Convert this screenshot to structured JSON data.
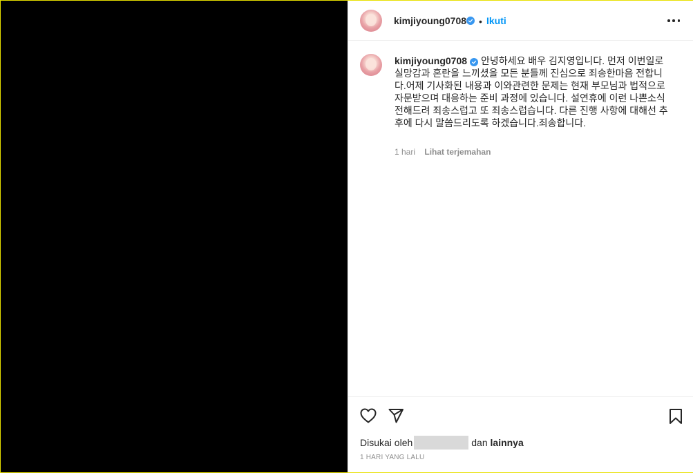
{
  "post": {
    "username": "kimjiyoung0708",
    "follow_label": "Ikuti",
    "separator": "•",
    "caption": "안녕하세요 배우 김지영입니다. 먼저 이번일로 실망감과 혼란을 느끼셨을 모든 분들께 진심으로 죄송한마음 전합니다.어제 기사화된 내용과 이와관련한 문제는 현재 부모님과 법적으로 자문받으며 대응하는 준비 과정에 있습니다. 설연휴에 이런 나쁜소식 전해드려 죄송스럽고 또 죄송스럽습니다. 다른 진행 사항에 대해선 추후에 다시 말씀드리도록 하겠습니다.죄송합니다.",
    "time_ago": "1 hari",
    "translate_label": "Lihat terjemahan"
  },
  "likes": {
    "prefix": "Disukai oleh",
    "middle": "dan",
    "others": "lainnya"
  },
  "date_label": "1 HARI YANG LALU",
  "icons": [
    "heart-icon",
    "share-icon",
    "bookmark-icon",
    "more-options-icon",
    "verified-badge-icon"
  ],
  "colors": {
    "accent": "#0095f6",
    "verified": "#3897f0",
    "media_background": "#000000"
  }
}
